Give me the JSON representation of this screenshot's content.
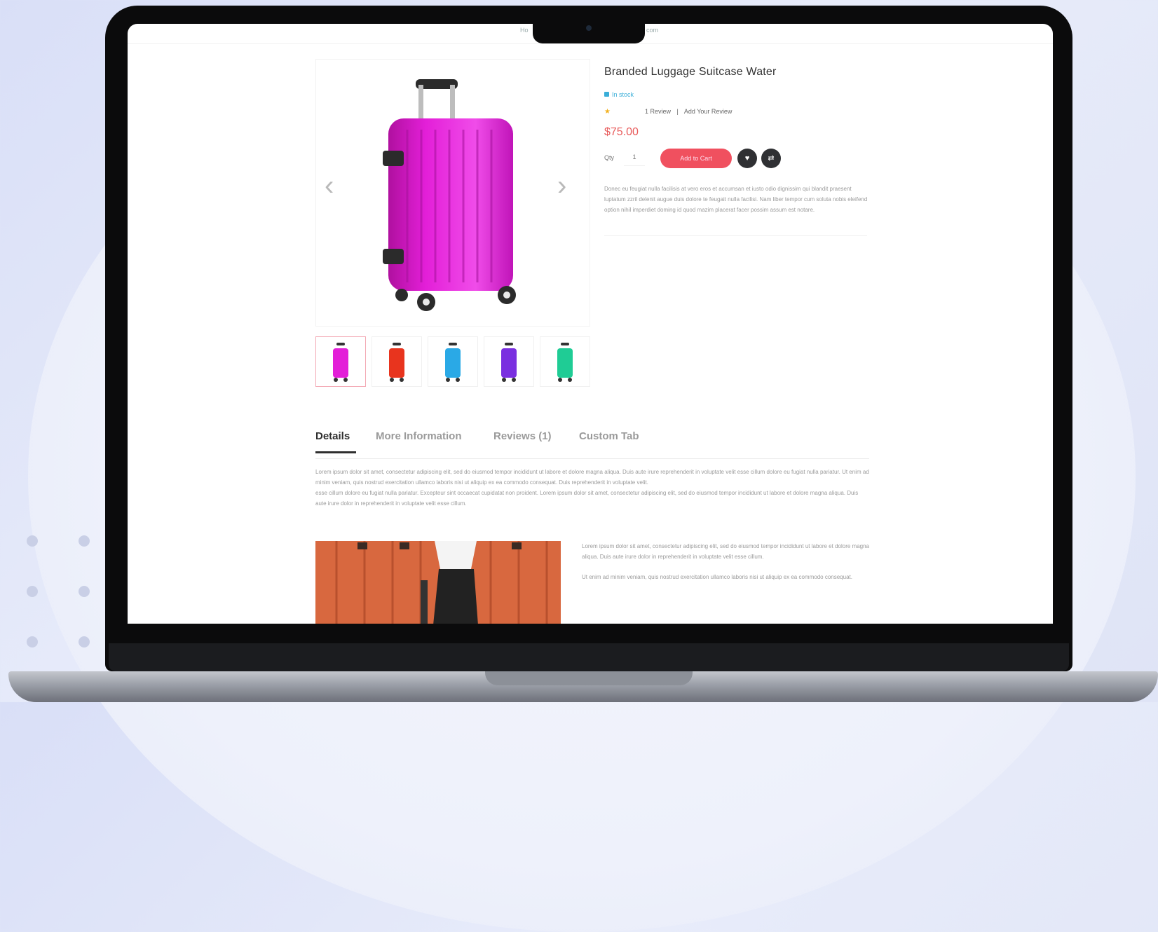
{
  "nav": {
    "left": "Ho",
    "right": "com"
  },
  "product": {
    "title": "Branded Luggage Suitcase Water",
    "stock": "In stock",
    "rating": {
      "stars": 1,
      "reviews_link": "1 Review",
      "separator": "|",
      "add_review": "Add Your Review"
    },
    "price": "$75.00",
    "qty_label": "Qty",
    "qty_value": "1",
    "add_to_cart": "Add to Cart",
    "description": "Donec eu feugiat nulla facilisis at vero eros et accumsan et iusto odio dignissim qui blandit praesent luptatum zzril delenit augue duis dolore te feugait nulla facilisi. Nam liber tempor cum soluta nobis eleifend option nihil imperdiet doming id quod mazim placerat facer possim assum est notare."
  },
  "gallery": {
    "main_color": "#e31fd8",
    "thumbs": [
      {
        "color": "#e31fd8"
      },
      {
        "color": "#e8341e"
      },
      {
        "color": "#2aa9e6"
      },
      {
        "color": "#7a2fe0"
      },
      {
        "color": "#1fcc95"
      }
    ]
  },
  "tabs": [
    {
      "label": "Details"
    },
    {
      "label": "More Information"
    },
    {
      "label": "Reviews (1)"
    },
    {
      "label": "Custom Tab"
    }
  ],
  "details": {
    "para1": "Lorem ipsum dolor sit amet, consectetur adipiscing elit, sed do eiusmod tempor incididunt ut labore et dolore magna aliqua. Duis aute irure reprehenderit in voluptate velit esse cillum dolore eu fugiat nulla pariatur. Ut enim ad minim veniam, quis nostrud exercitation ullamco laboris nisi ut aliquip ex ea commodo consequat. Duis reprehenderit in voluptate velit.",
    "para2": "esse cillum dolore eu fugiat nulla pariatur. Excepteur sint occaecat cupidatat non proident. Lorem ipsum dolor sit amet, consectetur adipiscing elit, sed do eiusmod tempor incididunt ut labore et dolore magna aliqua. Duis aute irure dolor in reprehenderit in voluptate velit esse cillum.",
    "side1": "Lorem ipsum dolor sit amet, consectetur adipiscing elit, sed do eiusmod tempor incididunt ut labore et dolore magna aliqua. Duis aute irure dolor in reprehenderit in voluptate velit esse cillum.",
    "side2": "Ut enim ad minim veniam, quis nostrud exercitation ullamco laboris nisi ut aliquip ex ea commodo consequat."
  },
  "icons": {
    "prev": "chevron-left-icon",
    "next": "chevron-right-icon",
    "wishlist": "heart-icon",
    "compare": "compare-icon"
  },
  "colors": {
    "price": "#e85a5a",
    "cart_button": "#f0505f",
    "stock": "#3aaed8",
    "star": "#f2b01e"
  }
}
